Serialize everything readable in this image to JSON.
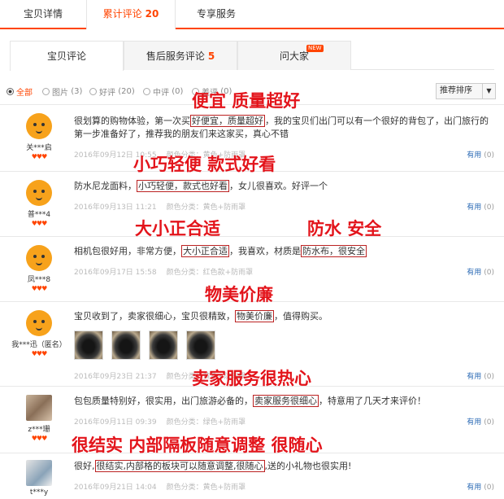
{
  "top_tabs": [
    {
      "label": "宝贝详情"
    },
    {
      "label": "累计评论",
      "count": "20"
    },
    {
      "label": "专享服务"
    }
  ],
  "sub_tabs": [
    {
      "label": "宝贝评论"
    },
    {
      "label": "售后服务评论",
      "count": "5"
    },
    {
      "label": "问大家",
      "badge": "NEW"
    }
  ],
  "filters": [
    {
      "label": "全部",
      "count": ""
    },
    {
      "label": "图片",
      "count": "(3)"
    },
    {
      "label": "好评",
      "count": "(20)"
    },
    {
      "label": "中评",
      "count": "(0)"
    },
    {
      "label": "差评",
      "count": "(0)"
    }
  ],
  "sort": {
    "label": "推荐排序",
    "caret": "▼"
  },
  "useful_label": "有用",
  "reviews": [
    {
      "user": "关***启",
      "hearts": "♥♥♥",
      "text_pre": "很划算的购物体验，第一次买",
      "text_box": "好便宜，质量超好",
      "text_post": "，我的宝贝们出门可以有一个很好的背包了，出门旅行的第一步准备好了，推荐我的朋友们来这家买，真心不错",
      "date": "2016年09月12日 10:55",
      "category": "颜色分类：黄色+防雨罩",
      "useful_count": "(0)",
      "overlay": "便宜 质量超好"
    },
    {
      "user": "普***4",
      "hearts": "♥♥♥",
      "text_pre": "防水尼龙面料，",
      "text_box": "小巧轻便，款式也好看",
      "text_post": "，女儿很喜欢。好评一个",
      "date": "2016年09月13日 11:21",
      "category": "颜色分类：黄色+防雨罩",
      "useful_count": "(0)",
      "overlay": "小巧轻便 款式好看"
    },
    {
      "user": "凤***8",
      "hearts": "♥♥♥",
      "text_pre": "相机包很好用，非常方便，",
      "text_box": "大小正合适",
      "text_mid": "，我喜欢，材质是",
      "text_box2": "防水布，很安全",
      "date": "2016年09月17日 15:58",
      "category": "颜色分类：红色款+防雨罩",
      "useful_count": "(0)",
      "overlay": "大小正合适",
      "overlay2": "防水  安全"
    },
    {
      "user": "我***迅（匿名）",
      "hearts": "♥♥♥",
      "text_pre": "宝贝收到了，卖家很细心，宝贝很精致，",
      "text_box": "物美价廉",
      "text_post": "，值得购买。",
      "date": "2016年09月23日 21:37",
      "category": "颜色分类：黄色+防雨罩",
      "useful_count": "(0)",
      "overlay": "物美价廉"
    },
    {
      "user": "z***珊",
      "hearts": "♥♥♥",
      "text_pre": "包包质量特别好，很实用，出门旅游必备的，",
      "text_box": "卖家服务很细心",
      "text_post": "，特意用了几天才来评价！",
      "date": "2016年09月11日 09:39",
      "category": "颜色分类：绿色+防雨罩",
      "useful_count": "(0)",
      "overlay": "卖家服务很热心"
    },
    {
      "user": "t***y",
      "hearts": "",
      "text_pre": "很好,",
      "text_box": "很结实,内部格的板块可以随意调整,很随心",
      "text_post": ",送的小礼物也很实用!",
      "date": "2016年09月21日 14:04",
      "category": "颜色分类：黄色+防雨罩",
      "useful_count": "(0)",
      "overlay": "很结实 内部隔板随意调整 很随心"
    }
  ]
}
